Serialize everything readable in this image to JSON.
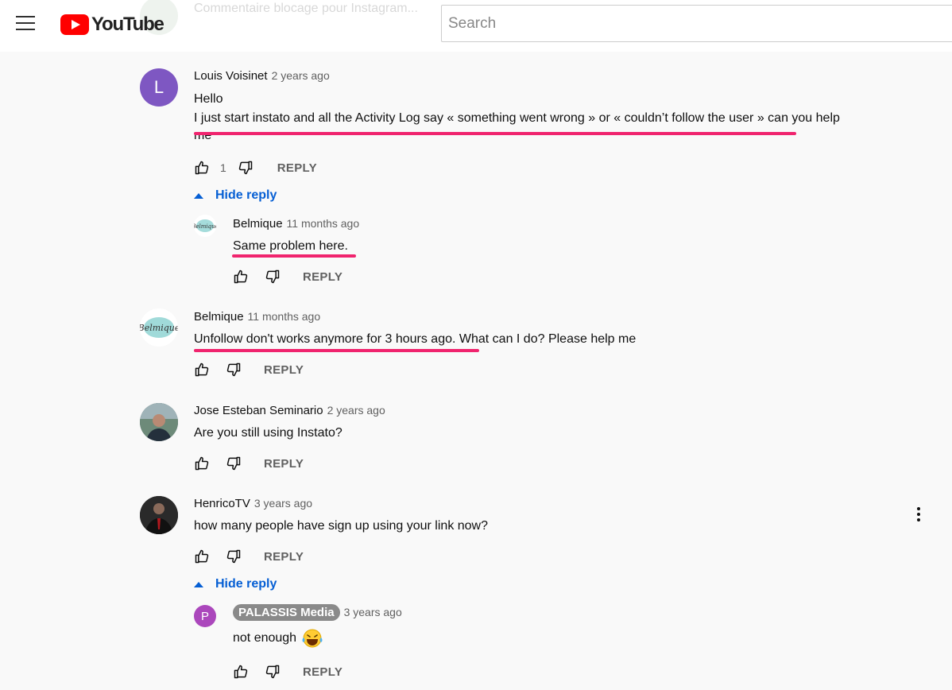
{
  "header": {
    "logo_text": "YouTube",
    "search_placeholder": "Search",
    "ghost_comment_text": "Commentaire blocage pour Instagram..."
  },
  "comments": [
    {
      "author": "Louis Voisinet",
      "time": "2 years ago",
      "avatar_letter": "L",
      "avatar_color": "#7e57c2",
      "text_line1": "Hello",
      "text_line2": "I just start instato and all the Activity Log say « something went wrong » or « couldn’t follow the user » can you help",
      "text_line3": "me",
      "likes": "1",
      "reply_label": "REPLY",
      "hide_reply_label": "Hide reply",
      "replies": [
        {
          "author": "Belmique",
          "time": "11 months ago",
          "avatar_text": "Belmique",
          "text": "Same problem here.",
          "reply_label": "REPLY"
        }
      ]
    },
    {
      "author": "Belmique",
      "time": "11 months ago",
      "avatar_text": "Belmique",
      "text": "Unfollow don't works anymore for 3 hours ago. What can I do? Please help me",
      "reply_label": "REPLY"
    },
    {
      "author": "Jose Esteban Seminario",
      "time": "2 years ago",
      "text": "Are you still using Instato?",
      "reply_label": "REPLY"
    },
    {
      "author": "HenricoTV",
      "time": "3 years ago",
      "text": "how many people have sign up using your link now?",
      "reply_label": "REPLY",
      "hide_reply_label": "Hide reply",
      "replies": [
        {
          "author": "PALASSIS Media",
          "time": "3 years ago",
          "avatar_letter": "P",
          "avatar_color": "#ab47bc",
          "text": "not enough",
          "emoji": "face-with-tears-of-joy",
          "reply_label": "REPLY"
        }
      ]
    }
  ],
  "colors": {
    "annotation_underline": "#f0246e",
    "link_blue": "#065fd4",
    "youtube_red": "#ff0000"
  }
}
